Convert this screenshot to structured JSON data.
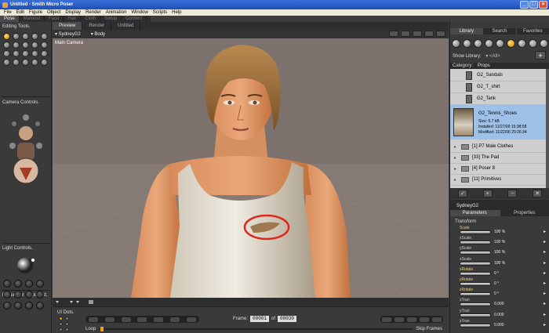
{
  "window": {
    "title": "Untitled - Smith Micro Poser",
    "min_label": "_",
    "max_label": "□",
    "close_label": "×"
  },
  "menu": [
    "File",
    "Edit",
    "Figure",
    "Object",
    "Display",
    "Render",
    "Animation",
    "Window",
    "Scripts",
    "Help"
  ],
  "rooms": [
    {
      "label": "Pose",
      "active": true
    },
    {
      "label": "Material",
      "active": false
    },
    {
      "label": "Face",
      "active": false
    },
    {
      "label": "Hair",
      "active": false
    },
    {
      "label": "Cloth",
      "active": false
    },
    {
      "label": "Setup",
      "active": false
    },
    {
      "label": "Content",
      "active": false
    }
  ],
  "left": {
    "editing_tools": "Editing Tools.",
    "camera_controls": "Camera Controls.",
    "light_controls": "Light Controls.",
    "document_display": "Document Display St."
  },
  "viewport": {
    "tabs": [
      {
        "label": "Preview",
        "active": true
      },
      {
        "label": "Render",
        "active": false
      },
      {
        "label": "Untitled",
        "active": false
      }
    ],
    "figure_select": "▾ SydneyG2",
    "actor_select": "▾ Body",
    "camera_label": "Main Camera",
    "annotation_color": "#e0271e"
  },
  "animation": {
    "ui_dots": "UI Dots.",
    "frame_label": "Frame:",
    "frame_current": "00001",
    "frame_of": "of",
    "frame_total": "00030",
    "loop_label": "Loop",
    "skip_frames_label": "Skip Frames"
  },
  "library": {
    "tabs": [
      {
        "label": "Library",
        "active": true
      },
      {
        "label": "Search",
        "active": false
      },
      {
        "label": "Favorites",
        "active": false
      }
    ],
    "show_library_label": "Show Library:",
    "show_library_value": "▾ <All>",
    "plus": "+",
    "category_label": "Category:",
    "category_value": "Props",
    "items": [
      "G2_Sandals",
      "G2_T_shirt",
      "G2_Tank"
    ],
    "selected": {
      "name": "G2_Tennis_Shoes",
      "size": "Size: 5.7 kB",
      "installed": "Installed: 11/27/09 15:38:58",
      "modified": "Modified: 11/22/06 20:26:34"
    },
    "folders": [
      "[1]  P7 Male Clothes",
      "[33]  The Pad",
      "[4]  Poser 8",
      "[11]  Primitives"
    ],
    "btn_apply": "✓",
    "btn_add": "+",
    "btn_remove": "−",
    "btn_delete": "✕"
  },
  "params": {
    "figure": "SydneyG2",
    "tabs": [
      {
        "label": "Parameters",
        "active": true
      },
      {
        "label": "Properties",
        "active": false
      }
    ],
    "group": "Transform",
    "dials": [
      {
        "label": "Scale",
        "value": "100 %",
        "hl": true
      },
      {
        "label": "xScale",
        "value": "100 %",
        "hl": false
      },
      {
        "label": "yScale",
        "value": "100 %",
        "hl": false
      },
      {
        "label": "zScale",
        "value": "100 %",
        "hl": false
      },
      {
        "label": "xRotate",
        "value": "0 °",
        "hl": true
      },
      {
        "label": "yRotate",
        "value": "0 °",
        "hl": true
      },
      {
        "label": "zRotate",
        "value": "0 °",
        "hl": true
      },
      {
        "label": "xTran",
        "value": "0.000",
        "hl": false
      },
      {
        "label": "yTran",
        "value": "0.000",
        "hl": false
      },
      {
        "label": "zTran",
        "value": "0.000",
        "hl": false
      }
    ]
  }
}
